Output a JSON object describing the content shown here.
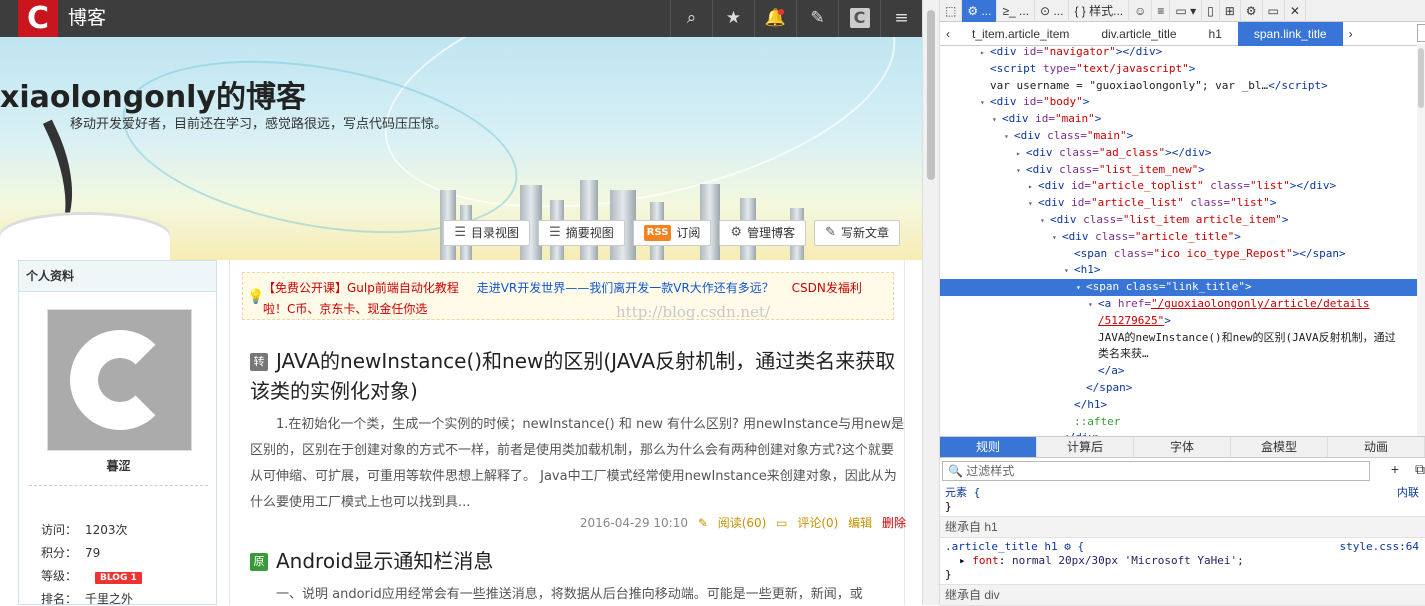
{
  "topbar": {
    "logo": "C",
    "brand": "博客",
    "icons": [
      "search-icon",
      "star-icon",
      "bell-icon",
      "edit-icon",
      "csdn-icon",
      "menu-icon"
    ]
  },
  "banner": {
    "title": "xiaolongonly的博客",
    "subtitle": "移动开发爱好者，目前还在学习，感觉路很远，写点代码压压惊。",
    "buttons": {
      "catalog": "目录视图",
      "summary": "摘要视图",
      "rss_badge": "RSS",
      "subscribe": "订阅",
      "manage": "管理博客",
      "write": "写新文章"
    }
  },
  "sidebar": {
    "heading": "个人资料",
    "nickname": "暮涩",
    "stats": [
      {
        "label": "访问：",
        "value": "1203次"
      },
      {
        "label": "积分：",
        "value": "79"
      },
      {
        "label": "等级：",
        "value": "BLOG 1"
      },
      {
        "label": "排名：",
        "value": "千里之外"
      }
    ]
  },
  "ad": {
    "links": [
      "【免费公开课】Gulp前端自动化教程",
      "走进VR开发世界——我们离开发一款VR大作还有多远？",
      "CSDN发福利啦！C币、京东卡、现金任你选"
    ]
  },
  "watermark": "http://blog.csdn.net/",
  "articles": [
    {
      "tag": "转",
      "title": "JAVA的newInstance()和new的区别(JAVA反射机制，通过类名来获取该类的实例化对象)",
      "desc": "1.在初始化一个类，生成一个实例的时候；newInstance() 和 new 有什么区别?       用newInstance与用new是区别的，区别在于创建对象的方式不一样，前者是使用类加载机制，那么为什么会有两种创建对象方式?这个就要从可伸缩、可扩展，可重用等软件思想上解释了。       Java中工厂模式经常使用newInstance来创建对象，因此从为什么要使用工厂模式上也可以找到具...",
      "date": "2016-04-29 10:10",
      "read": "阅读(60)",
      "comment": "评论(0)",
      "edit": "编辑",
      "delete": "删除"
    },
    {
      "tag": "原",
      "title": "Android显示通知栏消息",
      "desc": "一、说明 andorid应用经常会有一些推送消息，将数据从后台推向移动端。可能是一些更新，新闻，或"
    }
  ],
  "devtools": {
    "toolbar": [
      "⬚",
      "⚙ ...",
      "≥_ ...",
      "⊙ ...",
      "{ } 样式...",
      "☺",
      "≡",
      "▭ ▾",
      "▯",
      "⊞",
      "⚙",
      "▭",
      "✕"
    ],
    "breadcrumbs": [
      "t_item.article_item",
      "div.article_title",
      "h1",
      "span.link_title"
    ],
    "tree": [
      {
        "indent": 0,
        "tri": "▸",
        "html": "<span class='tg'>&lt;div </span><span class='at'>id=</span><span class='av'>\"navigator\"</span><span class='tg'>&gt;&lt;/div&gt;</span>"
      },
      {
        "indent": 0,
        "tri": "",
        "html": "<span class='tg'>&lt;script </span><span class='at'>type=</span><span class='av'>\"text/javascript\"</span><span class='tg'>&gt;</span>"
      },
      {
        "indent": 0,
        "tri": "",
        "html": "var username = \"guoxiaolongonly\"; var _bl…<span class='tg'>&lt;/script&gt;</span>"
      },
      {
        "indent": 0,
        "tri": "▾",
        "html": "<span class='tg'>&lt;div </span><span class='at'>id=</span><span class='av'>\"body\"</span><span class='tg'>&gt;</span>"
      },
      {
        "indent": 1,
        "tri": "▾",
        "html": "<span class='tg'>&lt;div </span><span class='at'>id=</span><span class='av'>\"main\"</span><span class='tg'>&gt;</span>"
      },
      {
        "indent": 2,
        "tri": "▾",
        "html": "<span class='tg'>&lt;div </span><span class='at'>class=</span><span class='av'>\"main\"</span><span class='tg'>&gt;</span>"
      },
      {
        "indent": 3,
        "tri": "▸",
        "html": "<span class='tg'>&lt;div </span><span class='at'>class=</span><span class='av'>\"ad_class\"</span><span class='tg'>&gt;&lt;/div&gt;</span>"
      },
      {
        "indent": 3,
        "tri": "▾",
        "html": "<span class='tg'>&lt;div </span><span class='at'>class=</span><span class='av'>\"list_item_new\"</span><span class='tg'>&gt;</span>"
      },
      {
        "indent": 4,
        "tri": "▸",
        "html": "<span class='tg'>&lt;div </span><span class='at'>id=</span><span class='av'>\"article_toplist\"</span> <span class='at'>class=</span><span class='av'>\"list\"</span><span class='tg'>&gt;&lt;/div&gt;</span>"
      },
      {
        "indent": 4,
        "tri": "▾",
        "html": "<span class='tg'>&lt;div </span><span class='at'>id=</span><span class='av'>\"article_list\"</span> <span class='at'>class=</span><span class='av'>\"list\"</span><span class='tg'>&gt;</span>"
      },
      {
        "indent": 5,
        "tri": "▾",
        "html": "<span class='tg'>&lt;div </span><span class='at'>class=</span><span class='av'>\"list_item article_item\"</span><span class='tg'>&gt;</span>"
      },
      {
        "indent": 6,
        "tri": "▾",
        "html": "<span class='tg'>&lt;div </span><span class='at'>class=</span><span class='av'>\"article_title\"</span><span class='tg'>&gt;</span>"
      },
      {
        "indent": 7,
        "tri": "",
        "html": "<span class='tg'>&lt;span </span><span class='at'>class=</span><span class='av'>\"ico ico_type_Repost\"</span><span class='tg'>&gt;&lt;/span&gt;</span>"
      },
      {
        "indent": 7,
        "tri": "▾",
        "html": "<span class='tg'>&lt;h1&gt;</span>"
      },
      {
        "indent": 8,
        "tri": "▾",
        "sel": true,
        "html": "<span class='tg'>&lt;span </span><span class='at'>class=</span><span class='av'>\"link_title\"</span><span class='tg'>&gt;</span>"
      },
      {
        "indent": 9,
        "tri": "▾",
        "html": "<span class='tg'>&lt;a </span><span class='at'>href=</span><span class='lk'>\"/guoxiaolongonly/article/details</span>"
      },
      {
        "indent": 9,
        "tri": "",
        "html": "<span class='lk'>/51279625\"</span><span class='tg'>&gt;</span>"
      },
      {
        "indent": 9,
        "tri": "",
        "html": "JAVA的newInstance()和new的区别(JAVA反射机制，通过"
      },
      {
        "indent": 9,
        "tri": "",
        "html": "类名来获…"
      },
      {
        "indent": 9,
        "tri": "",
        "html": "<span class='tg'>&lt;/a&gt;</span>"
      },
      {
        "indent": 8,
        "tri": "",
        "html": "<span class='tg'>&lt;/span&gt;</span>"
      },
      {
        "indent": 7,
        "tri": "",
        "html": "<span class='tg'>&lt;/h1&gt;</span>"
      },
      {
        "indent": 7,
        "tri": "",
        "html": "<span class='ps'>::after</span>"
      },
      {
        "indent": 6,
        "tri": "",
        "html": "<span class='tg'>&lt;/div&gt;</span>"
      }
    ],
    "panel_tabs": [
      "规则",
      "计算后",
      "字体",
      "盒模型",
      "动画"
    ],
    "filter_placeholder": "过滤样式",
    "styles": {
      "element_selector": "元素 {",
      "element_close": "}",
      "element_source": "内联",
      "inherit_label": "继承自 h1",
      "rule_selector": ".article_title h1 ⚙ {",
      "rule_source": "style.css:64",
      "rule_prop": "font",
      "rule_value": "normal 20px/30px 'Microsoft YaHei';",
      "rule_close": "}",
      "inherit_label2": "继承自 div"
    }
  }
}
